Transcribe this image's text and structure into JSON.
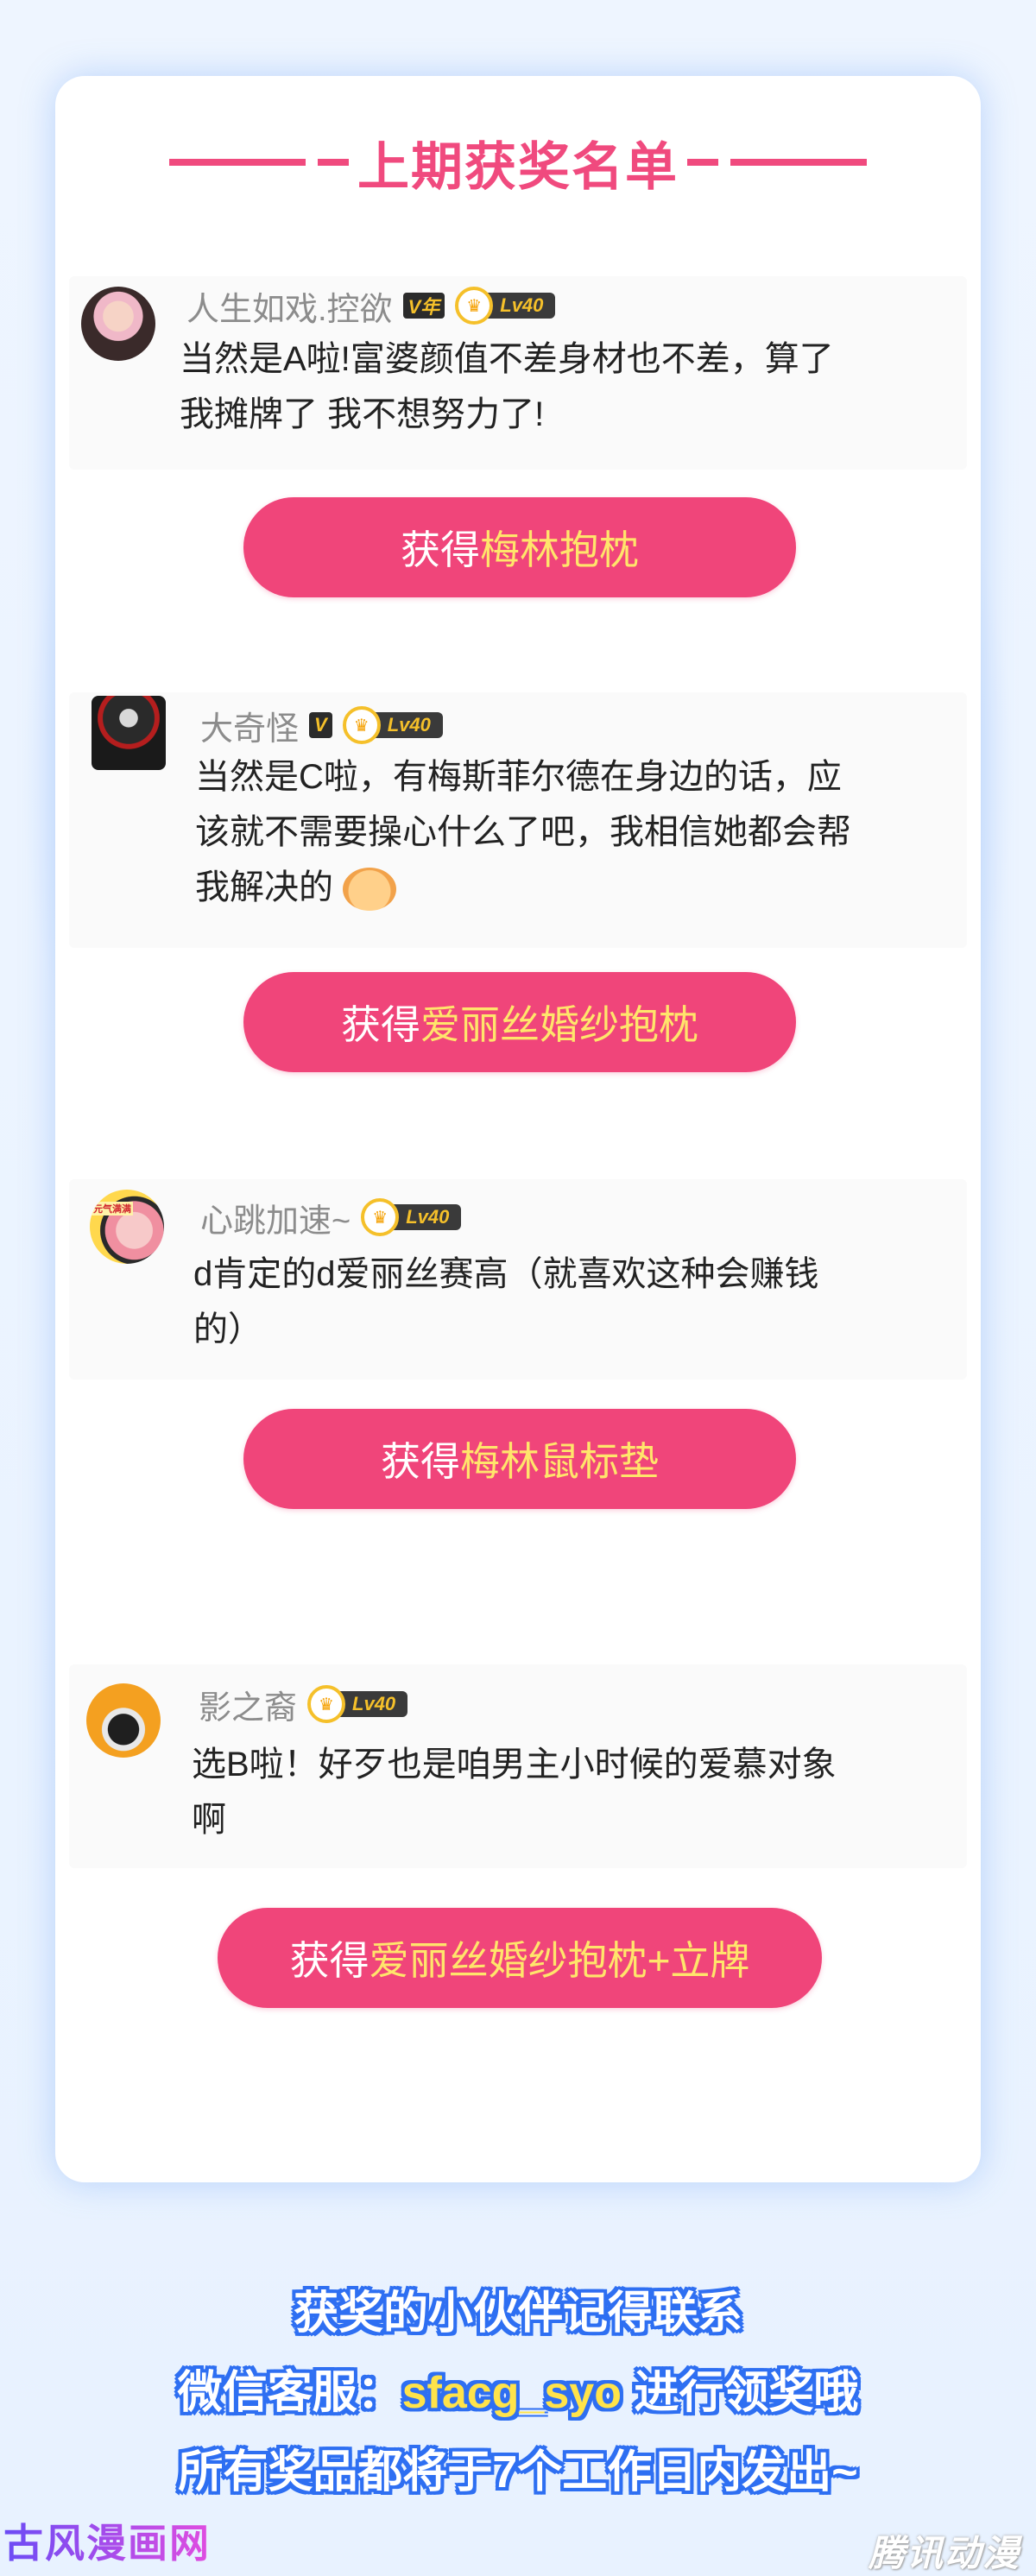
{
  "title": "上期获奖名单",
  "winners": [
    {
      "username": "人生如戏.控欲",
      "vip_badge": "V年",
      "level": "Lv40",
      "comment_lines": [
        "当然是A啦!富婆颜值不差身材也不差，算了",
        "我摊牌了 我不想努力了!"
      ],
      "button_prefix": "获得",
      "prize": "梅林抱枕"
    },
    {
      "username": "大奇怪",
      "vip_badge": "V",
      "level": "Lv40",
      "comment_lines": [
        "当然是C啦，有梅斯菲尔德在身边的话，应",
        "该就不需要操心什么了吧，我相信她都会帮",
        "我解决的"
      ],
      "button_prefix": "获得",
      "prize": "爱丽丝婚纱抱枕"
    },
    {
      "username": "心跳加速~",
      "level": "Lv40",
      "avatar_text": "元气满满",
      "comment_lines": [
        "d肯定的d爱丽丝赛高（就喜欢这种会赚钱",
        "的）"
      ],
      "button_prefix": "获得",
      "prize": "梅林鼠标垫"
    },
    {
      "username": "影之裔",
      "level": "Lv40",
      "comment_lines": [
        "选B啦！好歹也是咱男主小时候的爱慕对象",
        "啊"
      ],
      "button_prefix": "获得",
      "prize": "爱丽丝婚纱抱枕+立牌"
    }
  ],
  "footer": {
    "line1": "获奖的小伙伴记得联系",
    "line2_prefix": "微信客服：",
    "wechat": "sfacg_syo",
    "line2_suffix": " 进行领奖哦",
    "line3": "所有奖品都将于7个工作日内发出~"
  },
  "watermarks": {
    "left": "古风漫画网",
    "right": "腾讯动漫"
  },
  "colors": {
    "title_pink": "#f04a7e",
    "button_pink": "#f0457a",
    "prize_yellow": "#ffe56b",
    "footer_outline_blue": "#2e6ff2"
  }
}
